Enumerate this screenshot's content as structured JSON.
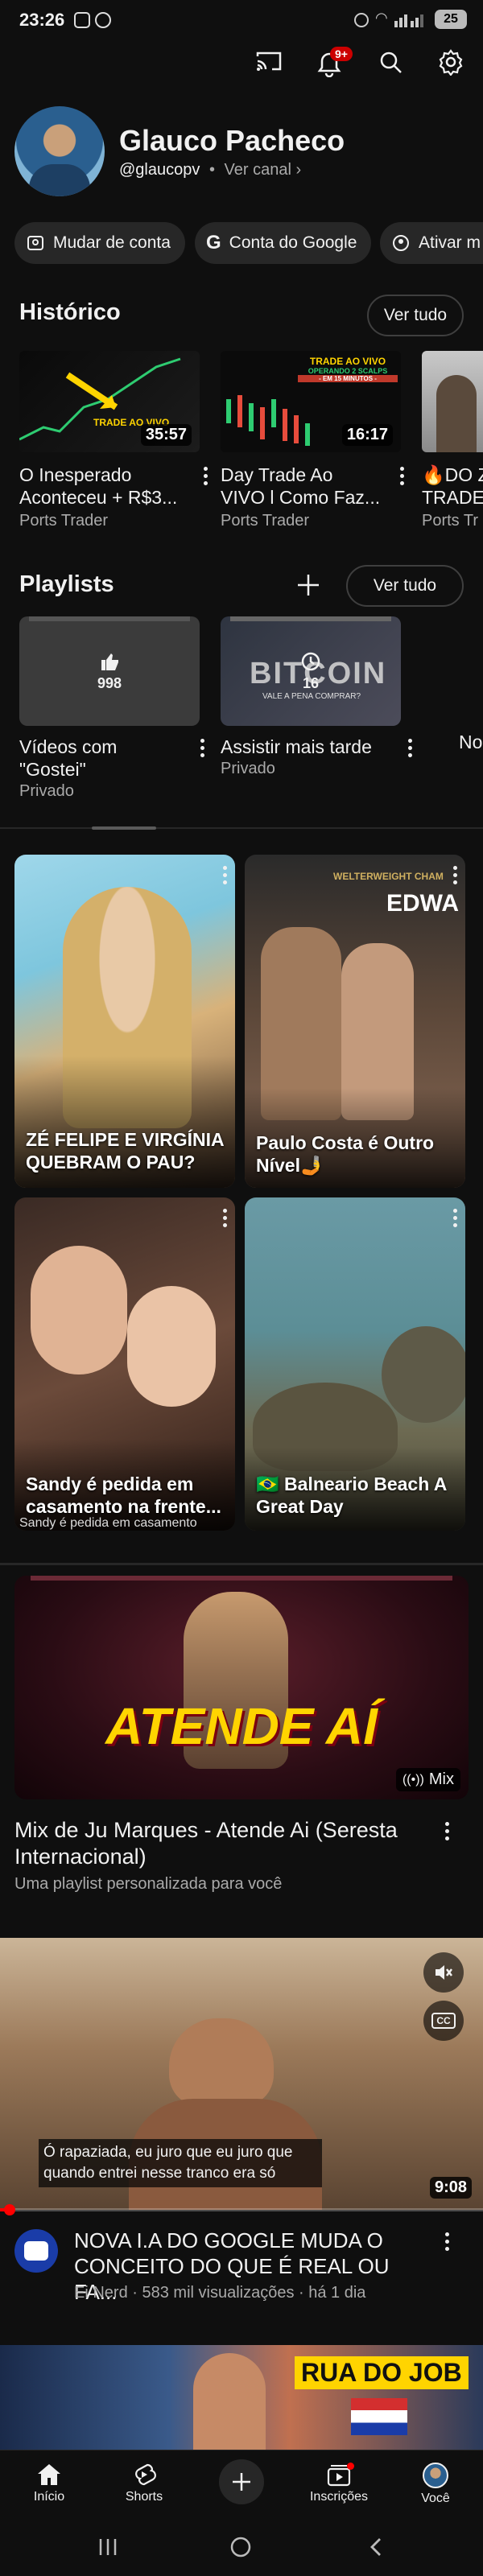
{
  "status_bar": {
    "time": "23:26",
    "battery": "25"
  },
  "header": {
    "notification_badge": "9+"
  },
  "profile": {
    "name": "Glauco Pacheco",
    "handle": "@glaucopv",
    "separator": "•",
    "view_channel": "Ver canal"
  },
  "account_chips": [
    {
      "label": "Mudar de conta",
      "icon": "account-switch-icon"
    },
    {
      "label": "Conta do Google",
      "icon": "google-g-icon"
    },
    {
      "label": "Ativar m",
      "icon": "incognito-icon"
    }
  ],
  "history": {
    "title": "Histórico",
    "see_all": "Ver tudo",
    "items": [
      {
        "title_line1": "O Inesperado",
        "title_line2": "Aconteceu + R$3...",
        "channel": "Ports Trader",
        "duration": "35:57",
        "thumb_text": "TRADE AO VIVO"
      },
      {
        "title_line1": "Day Trade Ao",
        "title_line2": "VIVO l Como Faz...",
        "channel": "Ports Trader",
        "duration": "16:17",
        "thumb_text": "TRADE AO VIVO",
        "thumb_text2": "OPERANDO 2 SCALPS",
        "thumb_text3": "- EM 15 MINUTOS -"
      },
      {
        "title_line1": "🔥DO Z",
        "title_line2": "TRADE",
        "channel": "Ports Tr"
      }
    ]
  },
  "playlists": {
    "title": "Playlists",
    "see_all": "Ver tudo",
    "items": [
      {
        "title_line1": "Vídeos com",
        "title_line2": "\"Gostei\"",
        "privacy": "Privado",
        "count": "998"
      },
      {
        "title_line1": "Assistir mais tarde",
        "privacy": "Privado",
        "count": "16",
        "thumb_text": "BITCOIN",
        "thumb_text2": "VALE A PENA COMPRAR?"
      },
      {
        "title_line1": "No"
      }
    ]
  },
  "shorts": [
    {
      "caption": "ZÉ FELIPE E VIRGÍNIA QUEBRAM O PAU?"
    },
    {
      "caption": "Paulo Costa é Outro Nível🤳",
      "thumb_text": "WELTERWEIGHT CHAM",
      "thumb_text2": "EDWA"
    },
    {
      "caption": "Sandy é pedida em casamento na frente...",
      "overlay": "Sandy é pedida em casamento"
    },
    {
      "caption": "🇧🇷 Balneario Beach A Great Day"
    }
  ],
  "mix": {
    "thumb_text": "ATENDE AÍ",
    "badge": "Mix",
    "title": "Mix de Ju Marques - Atende Ai (Seresta Internacional)",
    "subtitle": "Uma playlist personalizada para você"
  },
  "video": {
    "caption": "Ó rapaziada, eu juro que eu juro que quando entrei nesse tranco era só",
    "duration": "9:08",
    "title_line1": "NOVA I.A DO GOOGLE MUDA O",
    "title_line2": "CONCEITO DO QUE É REAL OU FA...",
    "channel": "Ei Nerd",
    "views": "583 mil visualizações",
    "age": "há 1 dia",
    "progress": 0.02
  },
  "next_video": {
    "thumb_text": "RUA DO JOB"
  },
  "bottom_nav": [
    {
      "label": "Início",
      "icon": "home-icon"
    },
    {
      "label": "Shorts",
      "icon": "shorts-icon"
    },
    {
      "label": "",
      "icon": "create-plus-icon"
    },
    {
      "label": "Inscrições",
      "icon": "subscriptions-icon"
    },
    {
      "label": "Você",
      "icon": "you-avatar-icon"
    }
  ],
  "colors": {
    "background": "#0f0f0f",
    "accent_red": "#ff0000",
    "chip_bg": "#272727",
    "gold_text": "#ffd400"
  }
}
